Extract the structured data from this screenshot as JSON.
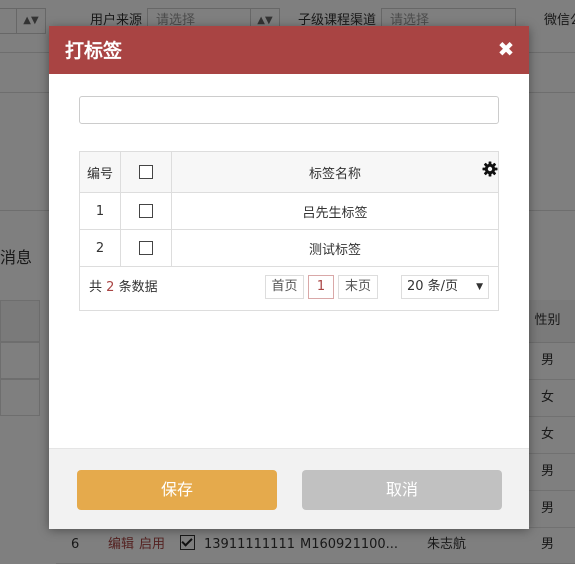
{
  "background": {
    "filters": {
      "user_source_label": "用户来源",
      "user_source_value": "请选择",
      "channel_label": "子级课程渠道",
      "channel_value": "请选择",
      "wechat_label": "微信公"
    },
    "section_label": "消息",
    "gender_header": "性别",
    "genders": [
      "男",
      "女",
      "女",
      "男",
      "男",
      "男"
    ],
    "last_row": {
      "index": "6",
      "edit": "编辑",
      "enable": "启用",
      "phone": "13911111111",
      "code": "M160921100...",
      "name": "朱志航"
    }
  },
  "modal": {
    "title": "打标签",
    "search_value": "",
    "table": {
      "headers": [
        "编号",
        "",
        "标签名称"
      ],
      "rows": [
        {
          "index": "1",
          "name": "吕先生标签"
        },
        {
          "index": "2",
          "name": "测试标签"
        }
      ]
    },
    "pager": {
      "total_prefix": "共",
      "total_count": "2",
      "total_suffix": "条数据",
      "first": "首页",
      "current": "1",
      "last": "末页",
      "page_size": "20 条/页"
    },
    "save_label": "保存",
    "cancel_label": "取消"
  },
  "colors": {
    "header": "#a94443",
    "save": "#e5aa4c",
    "cancel": "#c1c1c1"
  }
}
